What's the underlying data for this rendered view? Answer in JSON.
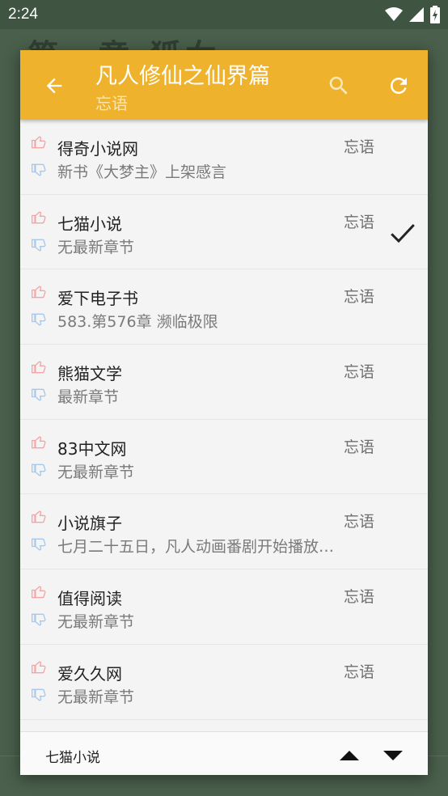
{
  "status_bar": {
    "time": "2:24"
  },
  "background": {
    "chapter_title": "第一章 狐女"
  },
  "dialog": {
    "title": "凡人修仙之仙界篇",
    "subtitle": "忘语",
    "sources": [
      {
        "name": "得奇小说网",
        "latest": "新书《大梦主》上架感言",
        "author": "忘语",
        "selected": false
      },
      {
        "name": "七猫小说",
        "latest": "无最新章节",
        "author": "忘语",
        "selected": true
      },
      {
        "name": "爱下电子书",
        "latest": "583.第576章 濒临极限",
        "author": "忘语",
        "selected": false
      },
      {
        "name": "熊猫文学",
        "latest": "最新章节",
        "author": "忘语",
        "selected": false
      },
      {
        "name": "83中文网",
        "latest": "无最新章节",
        "author": "忘语",
        "selected": false
      },
      {
        "name": "小说旗子",
        "latest": "七月二十五日，凡人动画番剧开始播放…",
        "author": "忘语",
        "selected": false
      },
      {
        "name": "值得阅读",
        "latest": "无最新章节",
        "author": "忘语",
        "selected": false
      },
      {
        "name": "爱久久网",
        "latest": "无最新章节",
        "author": "忘语",
        "selected": false
      }
    ],
    "footer": {
      "current_source": "七猫小说"
    },
    "colors": {
      "accent": "#efb22c",
      "thumb_up": "#f3a5a5",
      "thumb_down": "#a6c8ea"
    }
  }
}
